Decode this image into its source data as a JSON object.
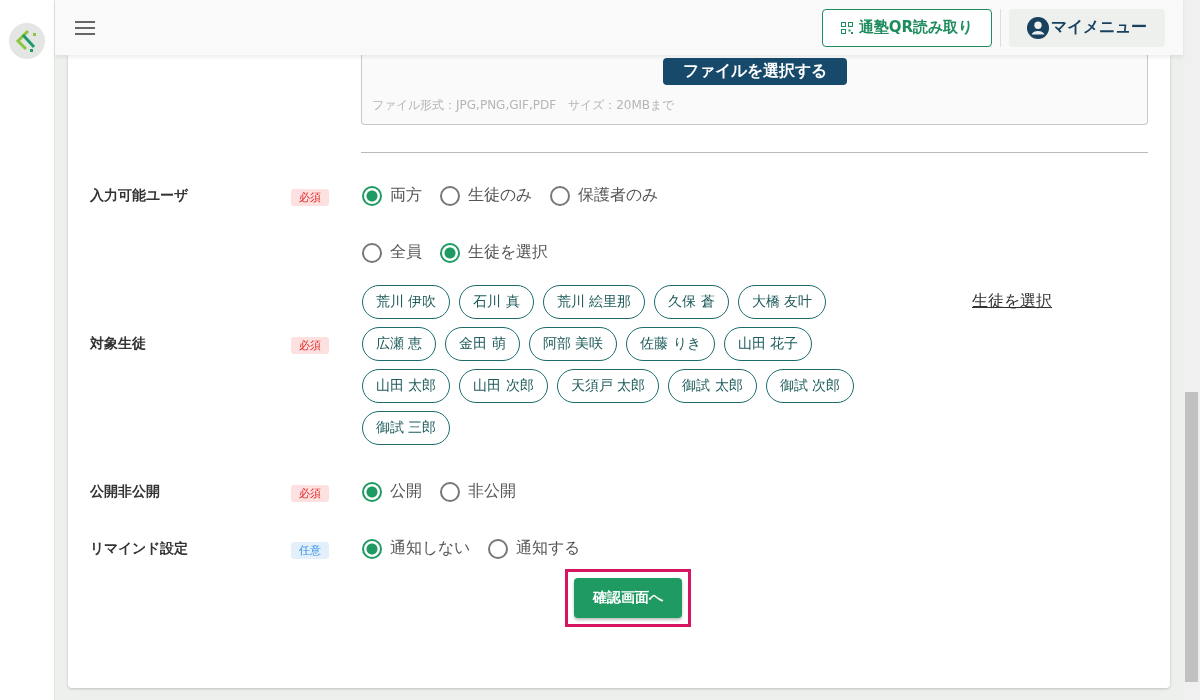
{
  "header": {
    "qr_button": "通塾QR読み取り",
    "my_menu": "マイメニュー"
  },
  "upload": {
    "button": "ファイルを選択する",
    "note": "ファイル形式：JPG,PNG,GIF,PDF　サイズ：20MBまで"
  },
  "fields": [
    {
      "kind": "radio",
      "label": "入力可能ユーザ",
      "badge": {
        "text": "必須",
        "kind": "required"
      },
      "options": [
        {
          "label": "両方",
          "selected": true
        },
        {
          "label": "生徒のみ",
          "selected": false
        },
        {
          "label": "保護者のみ",
          "selected": false
        }
      ]
    },
    {
      "kind": "students",
      "label": "対象生徒",
      "badge": {
        "text": "必須",
        "kind": "required"
      },
      "options": [
        {
          "label": "全員",
          "selected": false
        },
        {
          "label": "生徒を選択",
          "selected": true
        }
      ],
      "chips": [
        "荒川 伊吹",
        "石川 真",
        "荒川 絵里那",
        "久保 蒼",
        "大橋 友叶",
        "広瀬 恵",
        "金田 萌",
        "阿部 美咲",
        "佐藤 りき",
        "山田 花子",
        "山田 太郎",
        "山田 次郎",
        "天須戸 太郎",
        "御試 太郎",
        "御試 次郎",
        "御試 三郎"
      ],
      "link": "生徒を選択"
    },
    {
      "kind": "radio",
      "label": "公開非公開",
      "badge": {
        "text": "必須",
        "kind": "required"
      },
      "options": [
        {
          "label": "公開",
          "selected": true
        },
        {
          "label": "非公開",
          "selected": false
        }
      ]
    },
    {
      "kind": "radio",
      "label": "リマインド設定",
      "badge": {
        "text": "任意",
        "kind": "optional"
      },
      "options": [
        {
          "label": "通知しない",
          "selected": true
        },
        {
          "label": "通知する",
          "selected": false
        }
      ]
    }
  ],
  "submit": "確認画面へ"
}
